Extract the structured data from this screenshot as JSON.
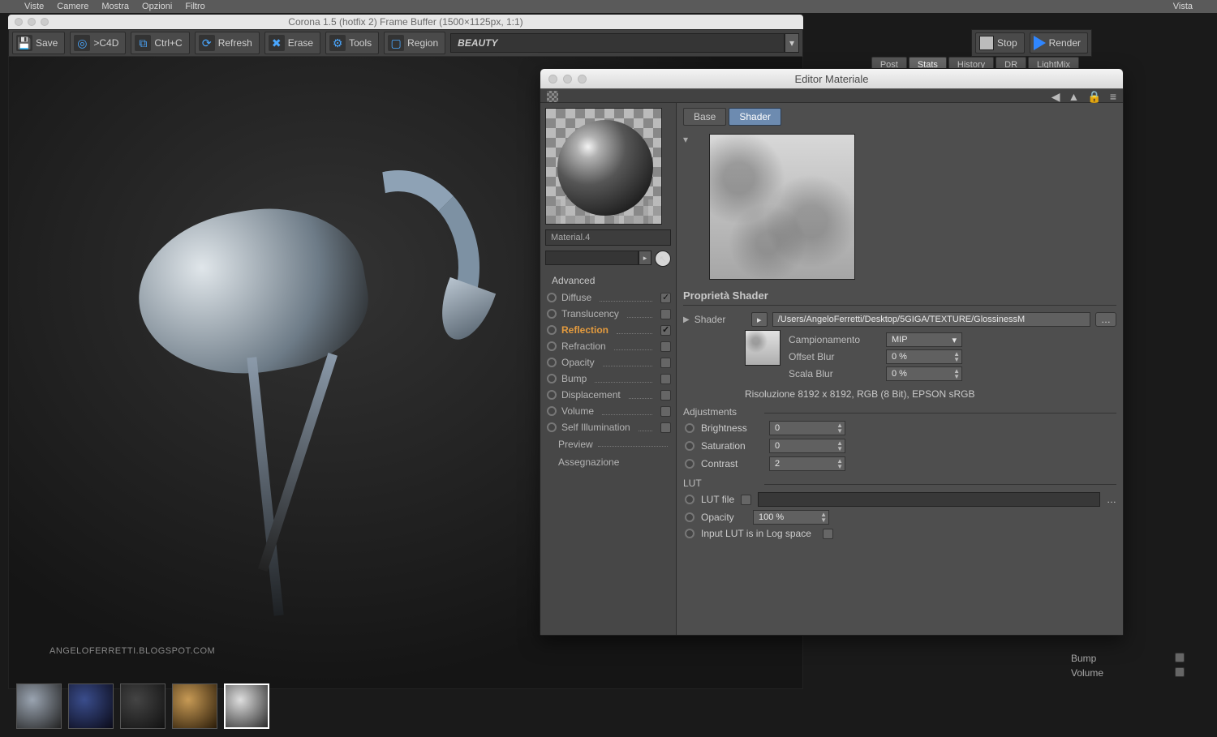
{
  "menubar": {
    "items": [
      "Viste",
      "Camere",
      "Mostra",
      "Opzioni",
      "Filtro",
      "",
      "Vista"
    ]
  },
  "frameBuffer": {
    "title": "Corona 1.5 (hotfix 2) Frame Buffer (1500×1125px, 1:1)",
    "buttons": {
      "save": "Save",
      "c4d": ">C4D",
      "ctrlc": "Ctrl+C",
      "refresh": "Refresh",
      "erase": "Erase",
      "tools": "Tools",
      "region": "Region"
    },
    "pass": "BEAUTY",
    "stop": "Stop",
    "render": "Render",
    "watermark": "ANGELOFERRETTI.BLOGSPOT.COM"
  },
  "subtabs": {
    "items": [
      "Post",
      "Stats",
      "History",
      "DR",
      "LightMix"
    ],
    "active": 1
  },
  "materialEditor": {
    "title": "Editor Materiale",
    "materialName": "Material.4",
    "advanced": "Advanced",
    "channels": [
      {
        "name": "Diffuse",
        "checked": true,
        "active": false
      },
      {
        "name": "Translucency",
        "checked": false,
        "active": false
      },
      {
        "name": "Reflection",
        "checked": true,
        "active": true
      },
      {
        "name": "Refraction",
        "checked": false,
        "active": false
      },
      {
        "name": "Opacity",
        "checked": false,
        "active": false
      },
      {
        "name": "Bump",
        "checked": false,
        "active": false
      },
      {
        "name": "Displacement",
        "checked": false,
        "active": false
      },
      {
        "name": "Volume",
        "checked": false,
        "active": false
      },
      {
        "name": "Self Illumination",
        "checked": false,
        "active": false
      }
    ],
    "extra": {
      "preview": "Preview",
      "assign": "Assegnazione"
    },
    "tabs": {
      "base": "Base",
      "shader": "Shader"
    },
    "shaderProps": {
      "title": "Proprietà Shader",
      "shaderLabel": "Shader",
      "path": "/Users/AngeloFerretti/Desktop/5GIGA/TEXTURE/GlossinessM",
      "sampling": {
        "label": "Campionamento",
        "value": "MIP"
      },
      "offsetBlur": {
        "label": "Offset Blur",
        "value": "0 %"
      },
      "scaleBlur": {
        "label": "Scala Blur",
        "value": "0 %"
      },
      "resolution": "Risoluzione 8192 x 8192, RGB (8 Bit), EPSON  sRGB"
    },
    "adjustments": {
      "title": "Adjustments",
      "brightness": {
        "label": "Brightness",
        "value": "0"
      },
      "saturation": {
        "label": "Saturation",
        "value": "0"
      },
      "contrast": {
        "label": "Contrast",
        "value": "2"
      }
    },
    "lut": {
      "title": "LUT",
      "file": "LUT file",
      "opacity": {
        "label": "Opacity",
        "value": "100 %"
      },
      "log": "Input LUT is in Log space"
    }
  },
  "rightProps": {
    "bump": "Bump",
    "volume": "Volume"
  }
}
